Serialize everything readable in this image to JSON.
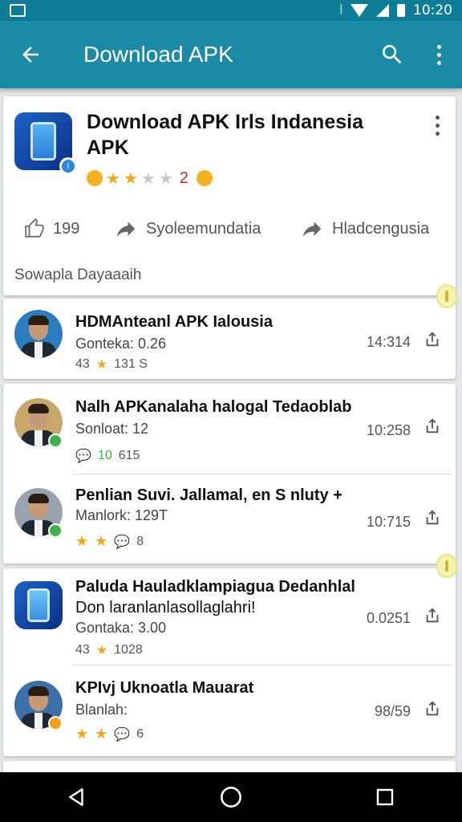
{
  "status_bar": {
    "time": "10:20"
  },
  "app_bar": {
    "title": "Download APK",
    "back_icon": "arrow-back-icon",
    "search_icon": "search-icon",
    "menu_icon": "more-vert-icon"
  },
  "app_card": {
    "name": "Download APK Irls Indanesia APK",
    "rating_value": "2",
    "stats": [
      {
        "icon": "thumb-up-icon",
        "label": "199"
      },
      {
        "icon": "share-arrow-icon",
        "label": "Syoleemundatia"
      },
      {
        "icon": "share-arrow-icon",
        "label": "Hladcengusia"
      }
    ],
    "footer": "Sowapla Dayaaaih"
  },
  "group1": [
    {
      "title": "HDMAnteanl APK Ialousia",
      "sub": "Gonteka: 0.26",
      "meta_a": "43",
      "meta_b": "131 S",
      "time": "14:314"
    },
    {
      "title": "Nalh  APKanalaha halogal Tedaoblab",
      "sub": "Sonloat: 12",
      "meta_a": "10",
      "meta_b": "615",
      "time": "10:258"
    },
    {
      "title": "Penlian Suvi. Jallamal, en S nluty +",
      "sub": "Manlork: 129T",
      "meta_a": "",
      "meta_b": "8",
      "time": "10:715"
    }
  ],
  "group2": [
    {
      "title": "Paluda Hauladklampiagua Dedanhlal",
      "title2": "Don laranlanlasollaglahri!",
      "sub": "Gontaka: 3.00",
      "meta_a": "43",
      "meta_b": "1028",
      "time": "0.0251"
    },
    {
      "title": "KPIvj Uknoatla Mauarat",
      "sub": "Blanlah:",
      "meta_a": "",
      "meta_b": "6",
      "time": "98/59"
    }
  ],
  "colors": {
    "app_bar": "#1a8aa5",
    "status_bar": "#0d7d96",
    "star": "#f1a81b",
    "online": "#3cb34a",
    "away": "#f59e1b"
  }
}
